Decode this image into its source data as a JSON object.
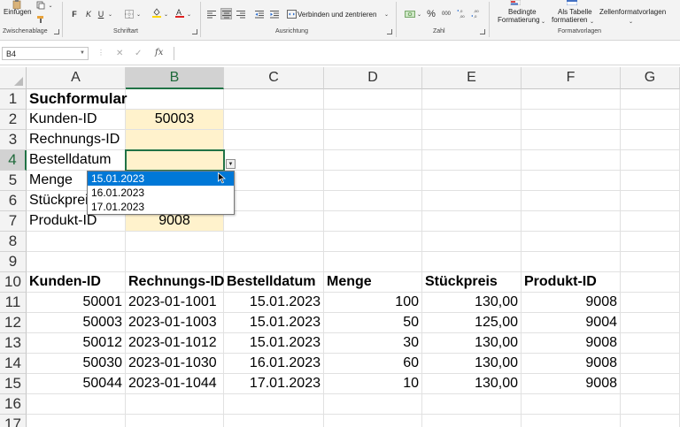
{
  "ribbon": {
    "paste_label": "Einfügen",
    "clipboard_group": "Zwischenablage",
    "font_group": "Schriftart",
    "alignment_group": "Ausrichtung",
    "number_group": "Zahl",
    "styles_group": "Formatvorlagen",
    "bold": "F",
    "italic": "K",
    "underline": "U",
    "merge_center": "Verbinden und zentrieren",
    "percent": "%",
    "thousands": "000",
    "conditional_formatting_l1": "Bedingte",
    "conditional_formatting_l2": "Formatierung",
    "format_as_table_l1": "Als Tabelle",
    "format_as_table_l2": "formatieren",
    "cell_styles": "Zellenformatvorlagen"
  },
  "formula_bar": {
    "name_box": "B4",
    "fx": "fx",
    "cancel": "✕",
    "enter": "✓",
    "content": ""
  },
  "columns": [
    "A",
    "B",
    "C",
    "D",
    "E",
    "F",
    "G"
  ],
  "rows": [
    "1",
    "2",
    "3",
    "4",
    "5",
    "6",
    "7",
    "8",
    "9",
    "10",
    "11",
    "12",
    "13",
    "14",
    "15",
    "16",
    "17"
  ],
  "search_form": {
    "title": "Suchformular",
    "fields": [
      {
        "label": "Kunden-ID",
        "value": "50003"
      },
      {
        "label": "Rechnungs-ID",
        "value": ""
      },
      {
        "label": "Bestelldatum",
        "value": ""
      },
      {
        "label": "Menge",
        "value": ""
      },
      {
        "label": "Stückpreis",
        "value": ""
      },
      {
        "label": "Produkt-ID",
        "value": "9008"
      }
    ]
  },
  "table": {
    "headers": [
      "Kunden-ID",
      "Rechnungs-ID",
      "Bestelldatum",
      "Menge",
      "Stückpreis",
      "Produkt-ID"
    ],
    "rows": [
      [
        "50001",
        "2023-01-1001",
        "15.01.2023",
        "100",
        "130,00",
        "9008"
      ],
      [
        "50003",
        "2023-01-1003",
        "15.01.2023",
        "50",
        "125,00",
        "9004"
      ],
      [
        "50012",
        "2023-01-1012",
        "15.01.2023",
        "30",
        "130,00",
        "9008"
      ],
      [
        "50030",
        "2023-01-1030",
        "16.01.2023",
        "60",
        "130,00",
        "9008"
      ],
      [
        "50044",
        "2023-01-1044",
        "17.01.2023",
        "10",
        "130,00",
        "9008"
      ]
    ]
  },
  "dropdown": {
    "options": [
      "15.01.2023",
      "16.01.2023",
      "17.01.2023"
    ],
    "selected_index": 0
  },
  "colors": {
    "fill": "#fff2cc",
    "selection": "#217346",
    "dropdown_highlight": "#0078d7"
  }
}
